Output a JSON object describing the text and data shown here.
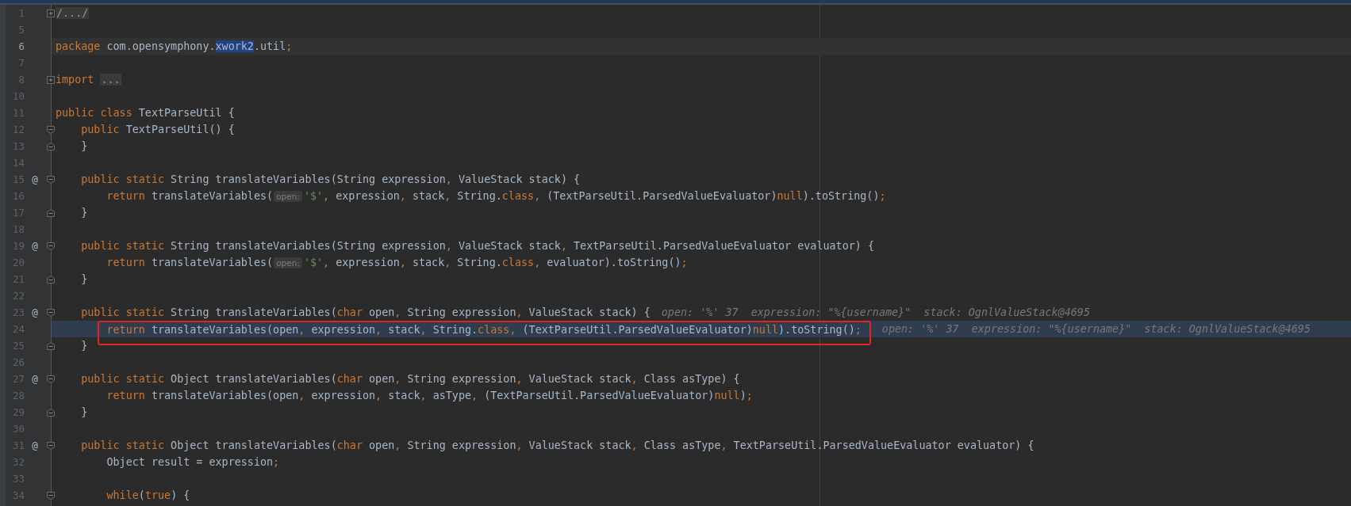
{
  "editor": {
    "lines": [
      {
        "number": "1",
        "fold": {
          "kind": "collapsed"
        },
        "caret_line": false,
        "execution_point": false,
        "boxed": false,
        "tokens": [
          {
            "kind": "folded",
            "text": "/.../"
          }
        ]
      },
      {
        "number": "5",
        "caret_line": false,
        "execution_point": false,
        "boxed": false
      },
      {
        "number": "6",
        "caret_line": true,
        "execution_point": false,
        "boxed": false,
        "tokens": [
          {
            "kind": "keyword",
            "text": "package"
          },
          {
            "kind": "plain",
            "text": " com.opensymphony."
          },
          {
            "kind": "selected",
            "text": "xwork2"
          },
          {
            "kind": "plain",
            "text": ".util"
          },
          {
            "kind": "punct",
            "text": ";"
          }
        ]
      },
      {
        "number": "7",
        "caret_line": false,
        "execution_point": false,
        "boxed": false
      },
      {
        "number": "8",
        "fold": {
          "kind": "collapsed"
        },
        "caret_line": false,
        "execution_point": false,
        "boxed": false,
        "tokens": [
          {
            "kind": "keyword",
            "text": "import"
          },
          {
            "kind": "folded",
            "text": "..."
          }
        ]
      },
      {
        "number": "10",
        "caret_line": false,
        "execution_point": false,
        "boxed": false
      },
      {
        "number": "11",
        "caret_line": false,
        "execution_point": false,
        "boxed": false,
        "tokens": [
          {
            "kind": "keyword",
            "text": "public class"
          },
          {
            "kind": "plain",
            "text": " TextParseUtil {"
          }
        ]
      },
      {
        "number": "12",
        "fold": {
          "kind": "start"
        },
        "caret_line": false,
        "execution_point": false,
        "boxed": false,
        "tokens": [
          {
            "kind": "keyword",
            "text": "    public"
          },
          {
            "kind": "plain",
            "text": " TextParseUtil() {"
          }
        ]
      },
      {
        "number": "13",
        "fold": {
          "kind": "end"
        },
        "caret_line": false,
        "execution_point": false,
        "boxed": false,
        "tokens": [
          {
            "kind": "plain",
            "text": "    }"
          }
        ]
      },
      {
        "number": "14",
        "caret_line": false,
        "execution_point": false,
        "boxed": false
      },
      {
        "number": "15",
        "annotation": "@",
        "fold": {
          "kind": "start"
        },
        "caret_line": false,
        "execution_point": false,
        "boxed": false,
        "tokens": [
          {
            "kind": "keyword",
            "text": "    public static"
          },
          {
            "kind": "plain",
            "text": " String translateVariables(String expression"
          },
          {
            "kind": "punct",
            "text": ","
          },
          {
            "kind": "plain",
            "text": " ValueStack stack) {"
          }
        ]
      },
      {
        "number": "16",
        "caret_line": false,
        "execution_point": false,
        "boxed": false,
        "tokens": [
          {
            "kind": "keyword",
            "text": "        return"
          },
          {
            "kind": "plain",
            "text": " translateVariables("
          },
          {
            "kind": "hint",
            "text": "open:"
          },
          {
            "kind": "string",
            "text": "'$'"
          },
          {
            "kind": "punct",
            "text": ","
          },
          {
            "kind": "plain",
            "text": " expression"
          },
          {
            "kind": "punct",
            "text": ","
          },
          {
            "kind": "plain",
            "text": " stack"
          },
          {
            "kind": "punct",
            "text": ","
          },
          {
            "kind": "plain",
            "text": " String."
          },
          {
            "kind": "keyword",
            "text": "class"
          },
          {
            "kind": "punct",
            "text": ","
          },
          {
            "kind": "plain",
            "text": " (TextParseUtil.ParsedValueEvaluator)"
          },
          {
            "kind": "keyword",
            "text": "null"
          },
          {
            "kind": "plain",
            "text": ").toString()"
          },
          {
            "kind": "punct",
            "text": ";"
          }
        ]
      },
      {
        "number": "17",
        "fold": {
          "kind": "end"
        },
        "caret_line": false,
        "execution_point": false,
        "boxed": false,
        "tokens": [
          {
            "kind": "plain",
            "text": "    }"
          }
        ]
      },
      {
        "number": "18",
        "caret_line": false,
        "execution_point": false,
        "boxed": false
      },
      {
        "number": "19",
        "annotation": "@",
        "fold": {
          "kind": "start"
        },
        "caret_line": false,
        "execution_point": false,
        "boxed": false,
        "tokens": [
          {
            "kind": "keyword",
            "text": "    public static"
          },
          {
            "kind": "plain",
            "text": " String translateVariables(String expression"
          },
          {
            "kind": "punct",
            "text": ","
          },
          {
            "kind": "plain",
            "text": " ValueStack stack"
          },
          {
            "kind": "punct",
            "text": ","
          },
          {
            "kind": "plain",
            "text": " TextParseUtil.ParsedValueEvaluator evaluator) {"
          }
        ]
      },
      {
        "number": "20",
        "caret_line": false,
        "execution_point": false,
        "boxed": false,
        "tokens": [
          {
            "kind": "keyword",
            "text": "        return"
          },
          {
            "kind": "plain",
            "text": " translateVariables("
          },
          {
            "kind": "hint",
            "text": "open:"
          },
          {
            "kind": "string",
            "text": "'$'"
          },
          {
            "kind": "punct",
            "text": ","
          },
          {
            "kind": "plain",
            "text": " expression"
          },
          {
            "kind": "punct",
            "text": ","
          },
          {
            "kind": "plain",
            "text": " stack"
          },
          {
            "kind": "punct",
            "text": ","
          },
          {
            "kind": "plain",
            "text": " String."
          },
          {
            "kind": "keyword",
            "text": "class"
          },
          {
            "kind": "punct",
            "text": ","
          },
          {
            "kind": "plain",
            "text": " evaluator).toString()"
          },
          {
            "kind": "punct",
            "text": ";"
          }
        ]
      },
      {
        "number": "21",
        "fold": {
          "kind": "end"
        },
        "caret_line": false,
        "execution_point": false,
        "boxed": false,
        "tokens": [
          {
            "kind": "plain",
            "text": "    }"
          }
        ]
      },
      {
        "number": "22",
        "caret_line": false,
        "execution_point": false,
        "boxed": false
      },
      {
        "number": "23",
        "annotation": "@",
        "fold": {
          "kind": "start"
        },
        "caret_line": false,
        "execution_point": false,
        "boxed": false,
        "tokens": [
          {
            "kind": "keyword",
            "text": "    public static"
          },
          {
            "kind": "plain",
            "text": " String translateVariables("
          },
          {
            "kind": "keyword",
            "text": "char"
          },
          {
            "kind": "plain",
            "text": " open"
          },
          {
            "kind": "punct",
            "text": ","
          },
          {
            "kind": "plain",
            "text": " String expression"
          },
          {
            "kind": "punct",
            "text": ","
          },
          {
            "kind": "plain",
            "text": " ValueStack stack) {"
          }
        ],
        "inline_values": "open: '%' 37  expression: \"%{username}\"  stack: OgnlValueStack@4695"
      },
      {
        "number": "24",
        "caret_line": false,
        "execution_point": true,
        "boxed": true,
        "tokens": [
          {
            "kind": "keyword",
            "text": "        return"
          },
          {
            "kind": "plain",
            "text": " translateVariables(open"
          },
          {
            "kind": "punct",
            "text": ","
          },
          {
            "kind": "plain",
            "text": " expression"
          },
          {
            "kind": "punct",
            "text": ","
          },
          {
            "kind": "plain",
            "text": " stack"
          },
          {
            "kind": "punct",
            "text": ","
          },
          {
            "kind": "plain",
            "text": " String."
          },
          {
            "kind": "keyword",
            "text": "class"
          },
          {
            "kind": "punct",
            "text": ","
          },
          {
            "kind": "plain",
            "text": " (TextParseUtil.ParsedValueEvaluator)"
          },
          {
            "kind": "keyword",
            "text": "null"
          },
          {
            "kind": "plain",
            "text": ").toString()"
          },
          {
            "kind": "punct",
            "text": ";"
          }
        ],
        "inline_values": "open: '%' 37  expression: \"%{username}\"  stack: OgnlValueStack@4695"
      },
      {
        "number": "25",
        "fold": {
          "kind": "end"
        },
        "caret_line": false,
        "execution_point": false,
        "boxed": false,
        "tokens": [
          {
            "kind": "plain",
            "text": "    }"
          }
        ]
      },
      {
        "number": "26",
        "caret_line": false,
        "execution_point": false,
        "boxed": false
      },
      {
        "number": "27",
        "annotation": "@",
        "fold": {
          "kind": "start"
        },
        "caret_line": false,
        "execution_point": false,
        "boxed": false,
        "tokens": [
          {
            "kind": "keyword",
            "text": "    public static"
          },
          {
            "kind": "plain",
            "text": " Object translateVariables("
          },
          {
            "kind": "keyword",
            "text": "char"
          },
          {
            "kind": "plain",
            "text": " open"
          },
          {
            "kind": "punct",
            "text": ","
          },
          {
            "kind": "plain",
            "text": " String expression"
          },
          {
            "kind": "punct",
            "text": ","
          },
          {
            "kind": "plain",
            "text": " ValueStack stack"
          },
          {
            "kind": "punct",
            "text": ","
          },
          {
            "kind": "plain",
            "text": " Class asType) {"
          }
        ]
      },
      {
        "number": "28",
        "caret_line": false,
        "execution_point": false,
        "boxed": false,
        "tokens": [
          {
            "kind": "keyword",
            "text": "        return"
          },
          {
            "kind": "plain",
            "text": " translateVariables(open"
          },
          {
            "kind": "punct",
            "text": ","
          },
          {
            "kind": "plain",
            "text": " expression"
          },
          {
            "kind": "punct",
            "text": ","
          },
          {
            "kind": "plain",
            "text": " stack"
          },
          {
            "kind": "punct",
            "text": ","
          },
          {
            "kind": "plain",
            "text": " asType"
          },
          {
            "kind": "punct",
            "text": ","
          },
          {
            "kind": "plain",
            "text": " (TextParseUtil.ParsedValueEvaluator)"
          },
          {
            "kind": "keyword",
            "text": "null"
          },
          {
            "kind": "plain",
            "text": ")"
          },
          {
            "kind": "punct",
            "text": ";"
          }
        ]
      },
      {
        "number": "29",
        "fold": {
          "kind": "end"
        },
        "caret_line": false,
        "execution_point": false,
        "boxed": false,
        "tokens": [
          {
            "kind": "plain",
            "text": "    }"
          }
        ]
      },
      {
        "number": "30",
        "caret_line": false,
        "execution_point": false,
        "boxed": false
      },
      {
        "number": "31",
        "annotation": "@",
        "fold": {
          "kind": "start"
        },
        "caret_line": false,
        "execution_point": false,
        "boxed": false,
        "tokens": [
          {
            "kind": "keyword",
            "text": "    public static"
          },
          {
            "kind": "plain",
            "text": " Object translateVariables("
          },
          {
            "kind": "keyword",
            "text": "char"
          },
          {
            "kind": "plain",
            "text": " open"
          },
          {
            "kind": "punct",
            "text": ","
          },
          {
            "kind": "plain",
            "text": " String expression"
          },
          {
            "kind": "punct",
            "text": ","
          },
          {
            "kind": "plain",
            "text": " ValueStack stack"
          },
          {
            "kind": "punct",
            "text": ","
          },
          {
            "kind": "plain",
            "text": " Class asType"
          },
          {
            "kind": "punct",
            "text": ","
          },
          {
            "kind": "plain",
            "text": " TextParseUtil.ParsedValueEvaluator evaluator) {"
          }
        ]
      },
      {
        "number": "32",
        "caret_line": false,
        "execution_point": false,
        "boxed": false,
        "tokens": [
          {
            "kind": "plain",
            "text": "        Object result = expression"
          },
          {
            "kind": "punct",
            "text": ";"
          }
        ]
      },
      {
        "number": "33",
        "caret_line": false,
        "execution_point": false,
        "boxed": false
      },
      {
        "number": "34",
        "fold": {
          "kind": "start"
        },
        "caret_line": false,
        "execution_point": false,
        "boxed": false,
        "tokens": [
          {
            "kind": "keyword",
            "text": "        while"
          },
          {
            "kind": "plain",
            "text": "("
          },
          {
            "kind": "keyword",
            "text": "true"
          },
          {
            "kind": "plain",
            "text": ") {"
          }
        ]
      }
    ]
  }
}
